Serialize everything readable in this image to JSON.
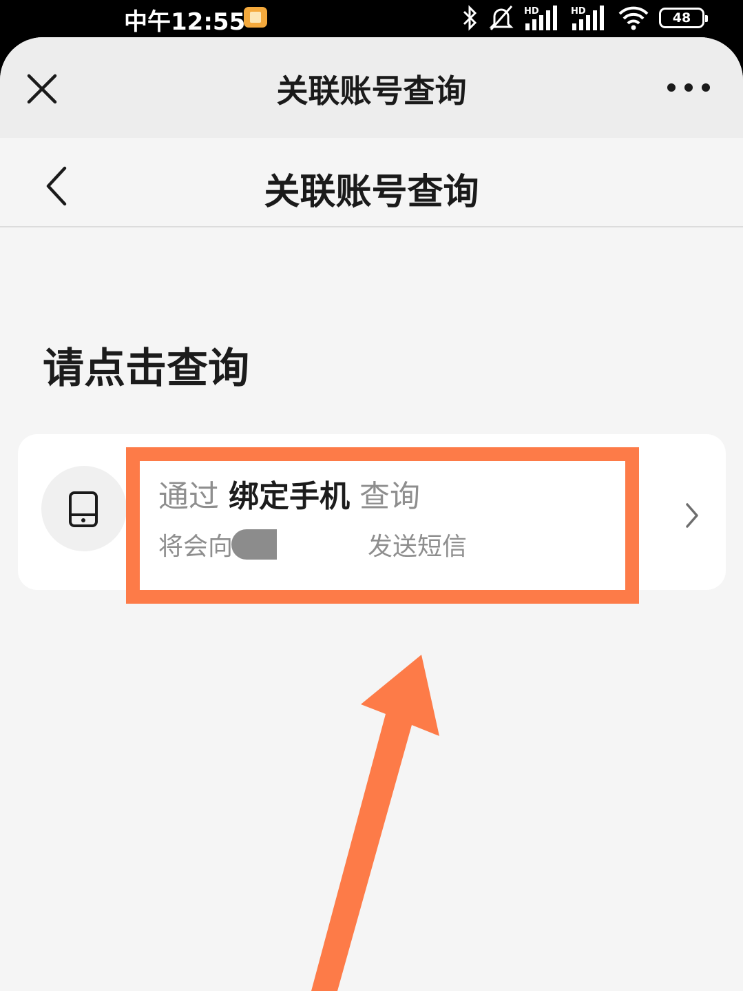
{
  "status_bar": {
    "time": "中午12:55",
    "battery": "48",
    "icons": [
      "bluetooth-icon",
      "silent-bell-icon",
      "hd-signal-icon",
      "hd-signal-icon",
      "wifi-icon",
      "battery-icon"
    ]
  },
  "mini_program_header": {
    "title": "关联账号查询"
  },
  "page_header": {
    "title": "关联账号查询"
  },
  "section_heading": "请点击查询",
  "option": {
    "title_prefix": "通过 ",
    "title_bold": "绑定手机",
    "title_suffix": " 查询",
    "desc_left": "将会向",
    "desc_right": "发送短信",
    "icon": "phone-icon"
  },
  "annotation": {
    "color": "#fd7b48"
  }
}
